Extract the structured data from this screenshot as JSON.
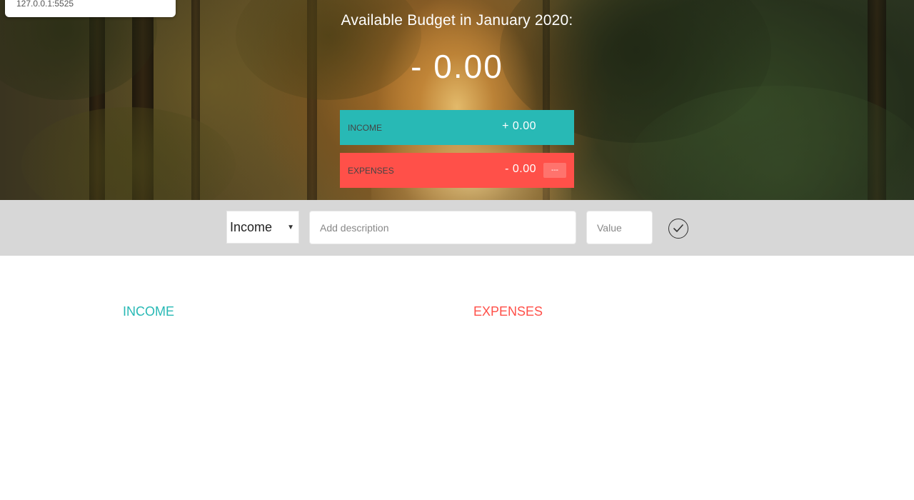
{
  "tooltip": {
    "url": "127.0.0.1:5525"
  },
  "budget": {
    "title": "Available Budget in January 2020:",
    "value": "- 0.00",
    "income": {
      "label": "INCOME",
      "value": "+ 0.00"
    },
    "expenses": {
      "label": "EXPENSES",
      "value": "- 0.00",
      "percentage": "---"
    }
  },
  "add_form": {
    "type_selected": "Income",
    "description_placeholder": "Add description",
    "value_placeholder": "Value",
    "submit_icon": "checkmark-circle-icon"
  },
  "lists": {
    "income_title": "INCOME",
    "expenses_title": "EXPENSES"
  },
  "colors": {
    "income": "#28b9b5",
    "expenses": "#ff5049",
    "add_bar": "#d7d7d7"
  }
}
